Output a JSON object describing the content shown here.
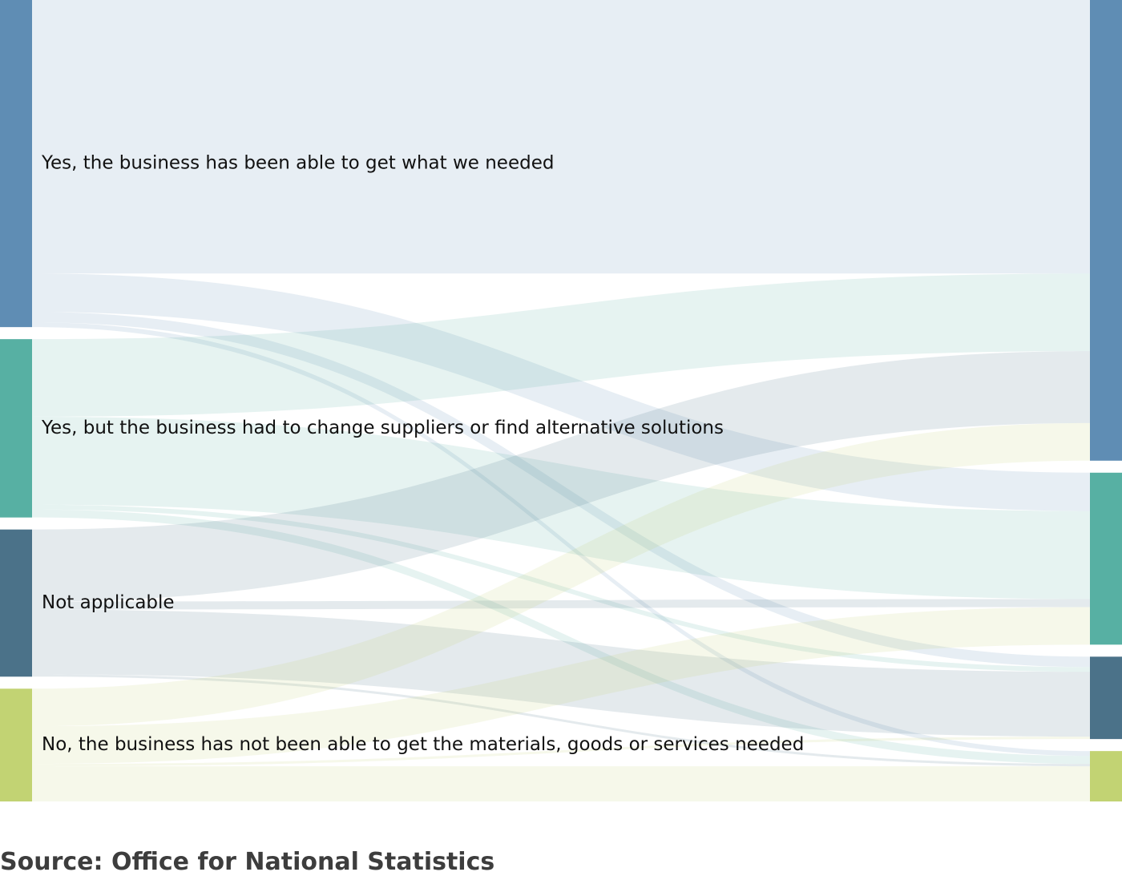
{
  "chart_data": {
    "type": "sankey",
    "nodes": [
      {
        "id": "yes",
        "label": "Yes, the business has been able to get what we needed",
        "color": "#5f8db4"
      },
      {
        "id": "change",
        "label": "Yes, but the business had to change suppliers or find alternative solutions",
        "color": "#57b0a3"
      },
      {
        "id": "na",
        "label": "Not applicable",
        "color": "#4b7289"
      },
      {
        "id": "no",
        "label": "No, the business has not been able to get the materials, goods or services needed",
        "color": "#c2d373"
      }
    ],
    "flows": [
      {
        "source": "yes",
        "target": "yes",
        "value": 34.2
      },
      {
        "source": "yes",
        "target": "change",
        "value": 4.8
      },
      {
        "source": "yes",
        "target": "na",
        "value": 1.3
      },
      {
        "source": "yes",
        "target": "no",
        "value": 0.6
      },
      {
        "source": "change",
        "target": "yes",
        "value": 9.7
      },
      {
        "source": "change",
        "target": "change",
        "value": 11.0
      },
      {
        "source": "change",
        "target": "na",
        "value": 0.6
      },
      {
        "source": "change",
        "target": "no",
        "value": 1.0
      },
      {
        "source": "na",
        "target": "yes",
        "value": 9.0
      },
      {
        "source": "na",
        "target": "change",
        "value": 1.0
      },
      {
        "source": "na",
        "target": "na",
        "value": 8.1
      },
      {
        "source": "na",
        "target": "no",
        "value": 0.3
      },
      {
        "source": "no",
        "target": "yes",
        "value": 4.7
      },
      {
        "source": "no",
        "target": "change",
        "value": 4.7
      },
      {
        "source": "no",
        "target": "na",
        "value": 0.3
      },
      {
        "source": "no",
        "target": "no",
        "value": 4.4
      }
    ],
    "link_color_by": "source",
    "link_opacity": 0.15
  },
  "source_note": "Source: Office for National Statistics"
}
